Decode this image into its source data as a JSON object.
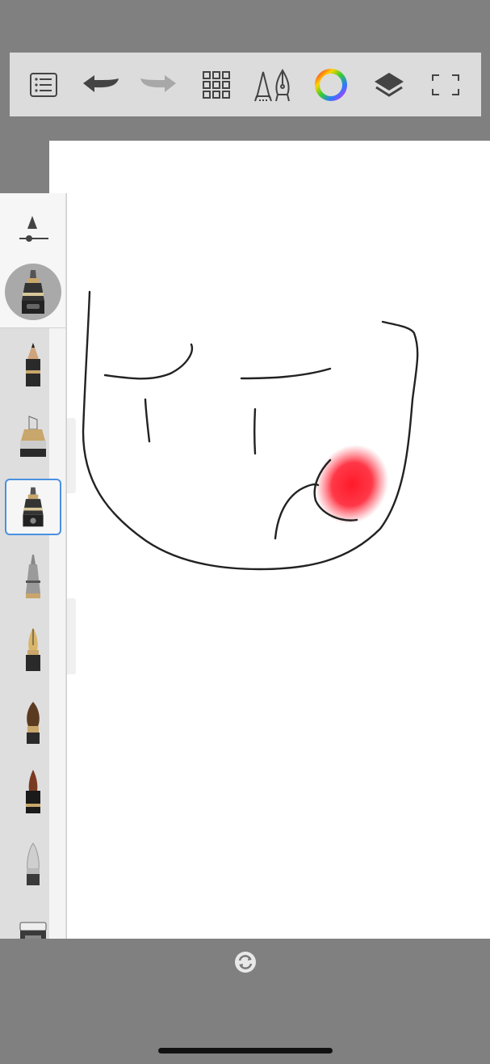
{
  "toolbar": {
    "buttons": [
      {
        "icon": "list-icon"
      },
      {
        "icon": "undo-icon"
      },
      {
        "icon": "redo-icon",
        "state": "disabled"
      },
      {
        "icon": "grid-icon"
      },
      {
        "icon": "brush-library-icon"
      },
      {
        "icon": "color-wheel-icon"
      },
      {
        "icon": "layers-icon"
      },
      {
        "icon": "fullscreen-icon"
      }
    ]
  },
  "brush_panel": {
    "selected_brush": "ballpoint-pen",
    "brushes": [
      "pencil",
      "marker",
      "ballpoint-pen",
      "airbrush",
      "fountain-pen",
      "paintbrush",
      "ink-brush",
      "eraser",
      "smudge"
    ],
    "size_slider_value": 0.2
  },
  "colors": {
    "toolbar_bg": "#dcdcdc",
    "canvas_bg": "#ffffff",
    "stroke": "#222222",
    "selection_accent": "#4a90e2",
    "blush": "#ff1a2a"
  }
}
